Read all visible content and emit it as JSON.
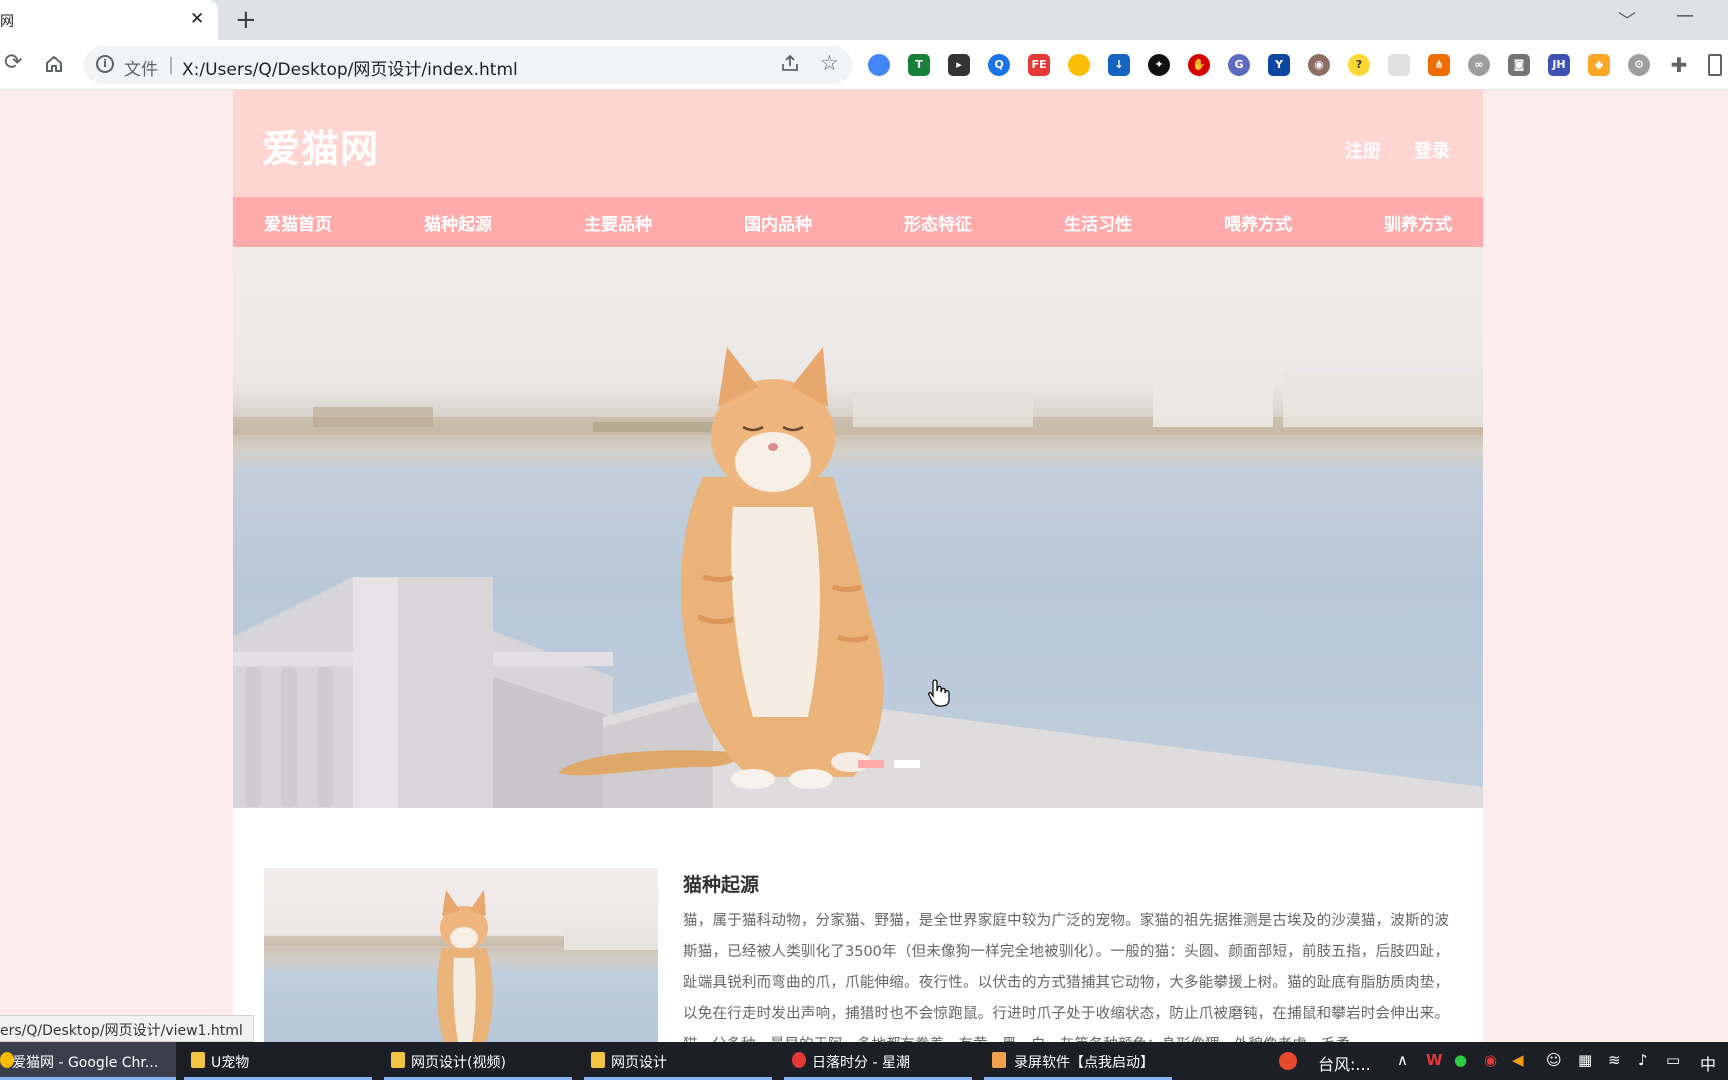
{
  "browser": {
    "tab_title": "网",
    "close_glyph": "✕",
    "new_tab_glyph": "+",
    "file_label": "文件",
    "separator": "|",
    "url": "X:/Users/Q/Desktop/网页设计/index.html",
    "status_url": "ers/Q/Desktop/网页设计/view1.html"
  },
  "site": {
    "logo": "爱猫网",
    "auth": {
      "register": "注册",
      "login": "登录"
    },
    "nav": [
      "爱猫首页",
      "猫种起源",
      "主要品种",
      "国内品种",
      "形态特征",
      "生活习性",
      "喂养方式",
      "驯养方式"
    ],
    "article": {
      "title": "猫种起源",
      "body": "猫，属于猫科动物，分家猫、野猫，是全世界家庭中较为广泛的宠物。家猫的祖先据推测是古埃及的沙漠猫，波斯的波斯猫，已经被人类驯化了3500年（但未像狗一样完全地被驯化）。一般的猫：头圆、颜面部短，前肢五指，后肢四趾，趾端具锐利而弯曲的爪，爪能伸缩。夜行性。以伏击的方式猎捕其它动物，大多能攀援上树。猫的趾底有脂肪质肉垫，以免在行走时发出声响，捕猎时也不会惊跑鼠。行进时爪子处于收缩状态，防止爪被磨钝，在捕鼠和攀岩时会伸出来。猫，分多种，最早的于阿，多地都有豢养。有黄、黑、白、灰等各种颜色；身形像狸，外貌像老虎，毛柔"
    },
    "colors": {
      "header": "#ffd5d2",
      "nav": "#ffabab",
      "background": "#fdecec",
      "dot_active": "#ffabab",
      "dot_inactive": "#ffffff"
    }
  },
  "taskbar": {
    "items": [
      {
        "label": "爱猫网 - Google Chr...",
        "icon": "chrome-icon"
      },
      {
        "label": "U宠物",
        "icon": "folder-icon"
      },
      {
        "label": "网页设计(视频)",
        "icon": "folder-icon"
      },
      {
        "label": "网页设计",
        "icon": "folder-icon"
      },
      {
        "label": "日落时分 - 星潮",
        "icon": "netease-music-icon"
      },
      {
        "label": "录屏软件【点我启动】",
        "icon": "recorder-icon"
      }
    ],
    "tray_text": "台风:...",
    "ime": "中"
  }
}
